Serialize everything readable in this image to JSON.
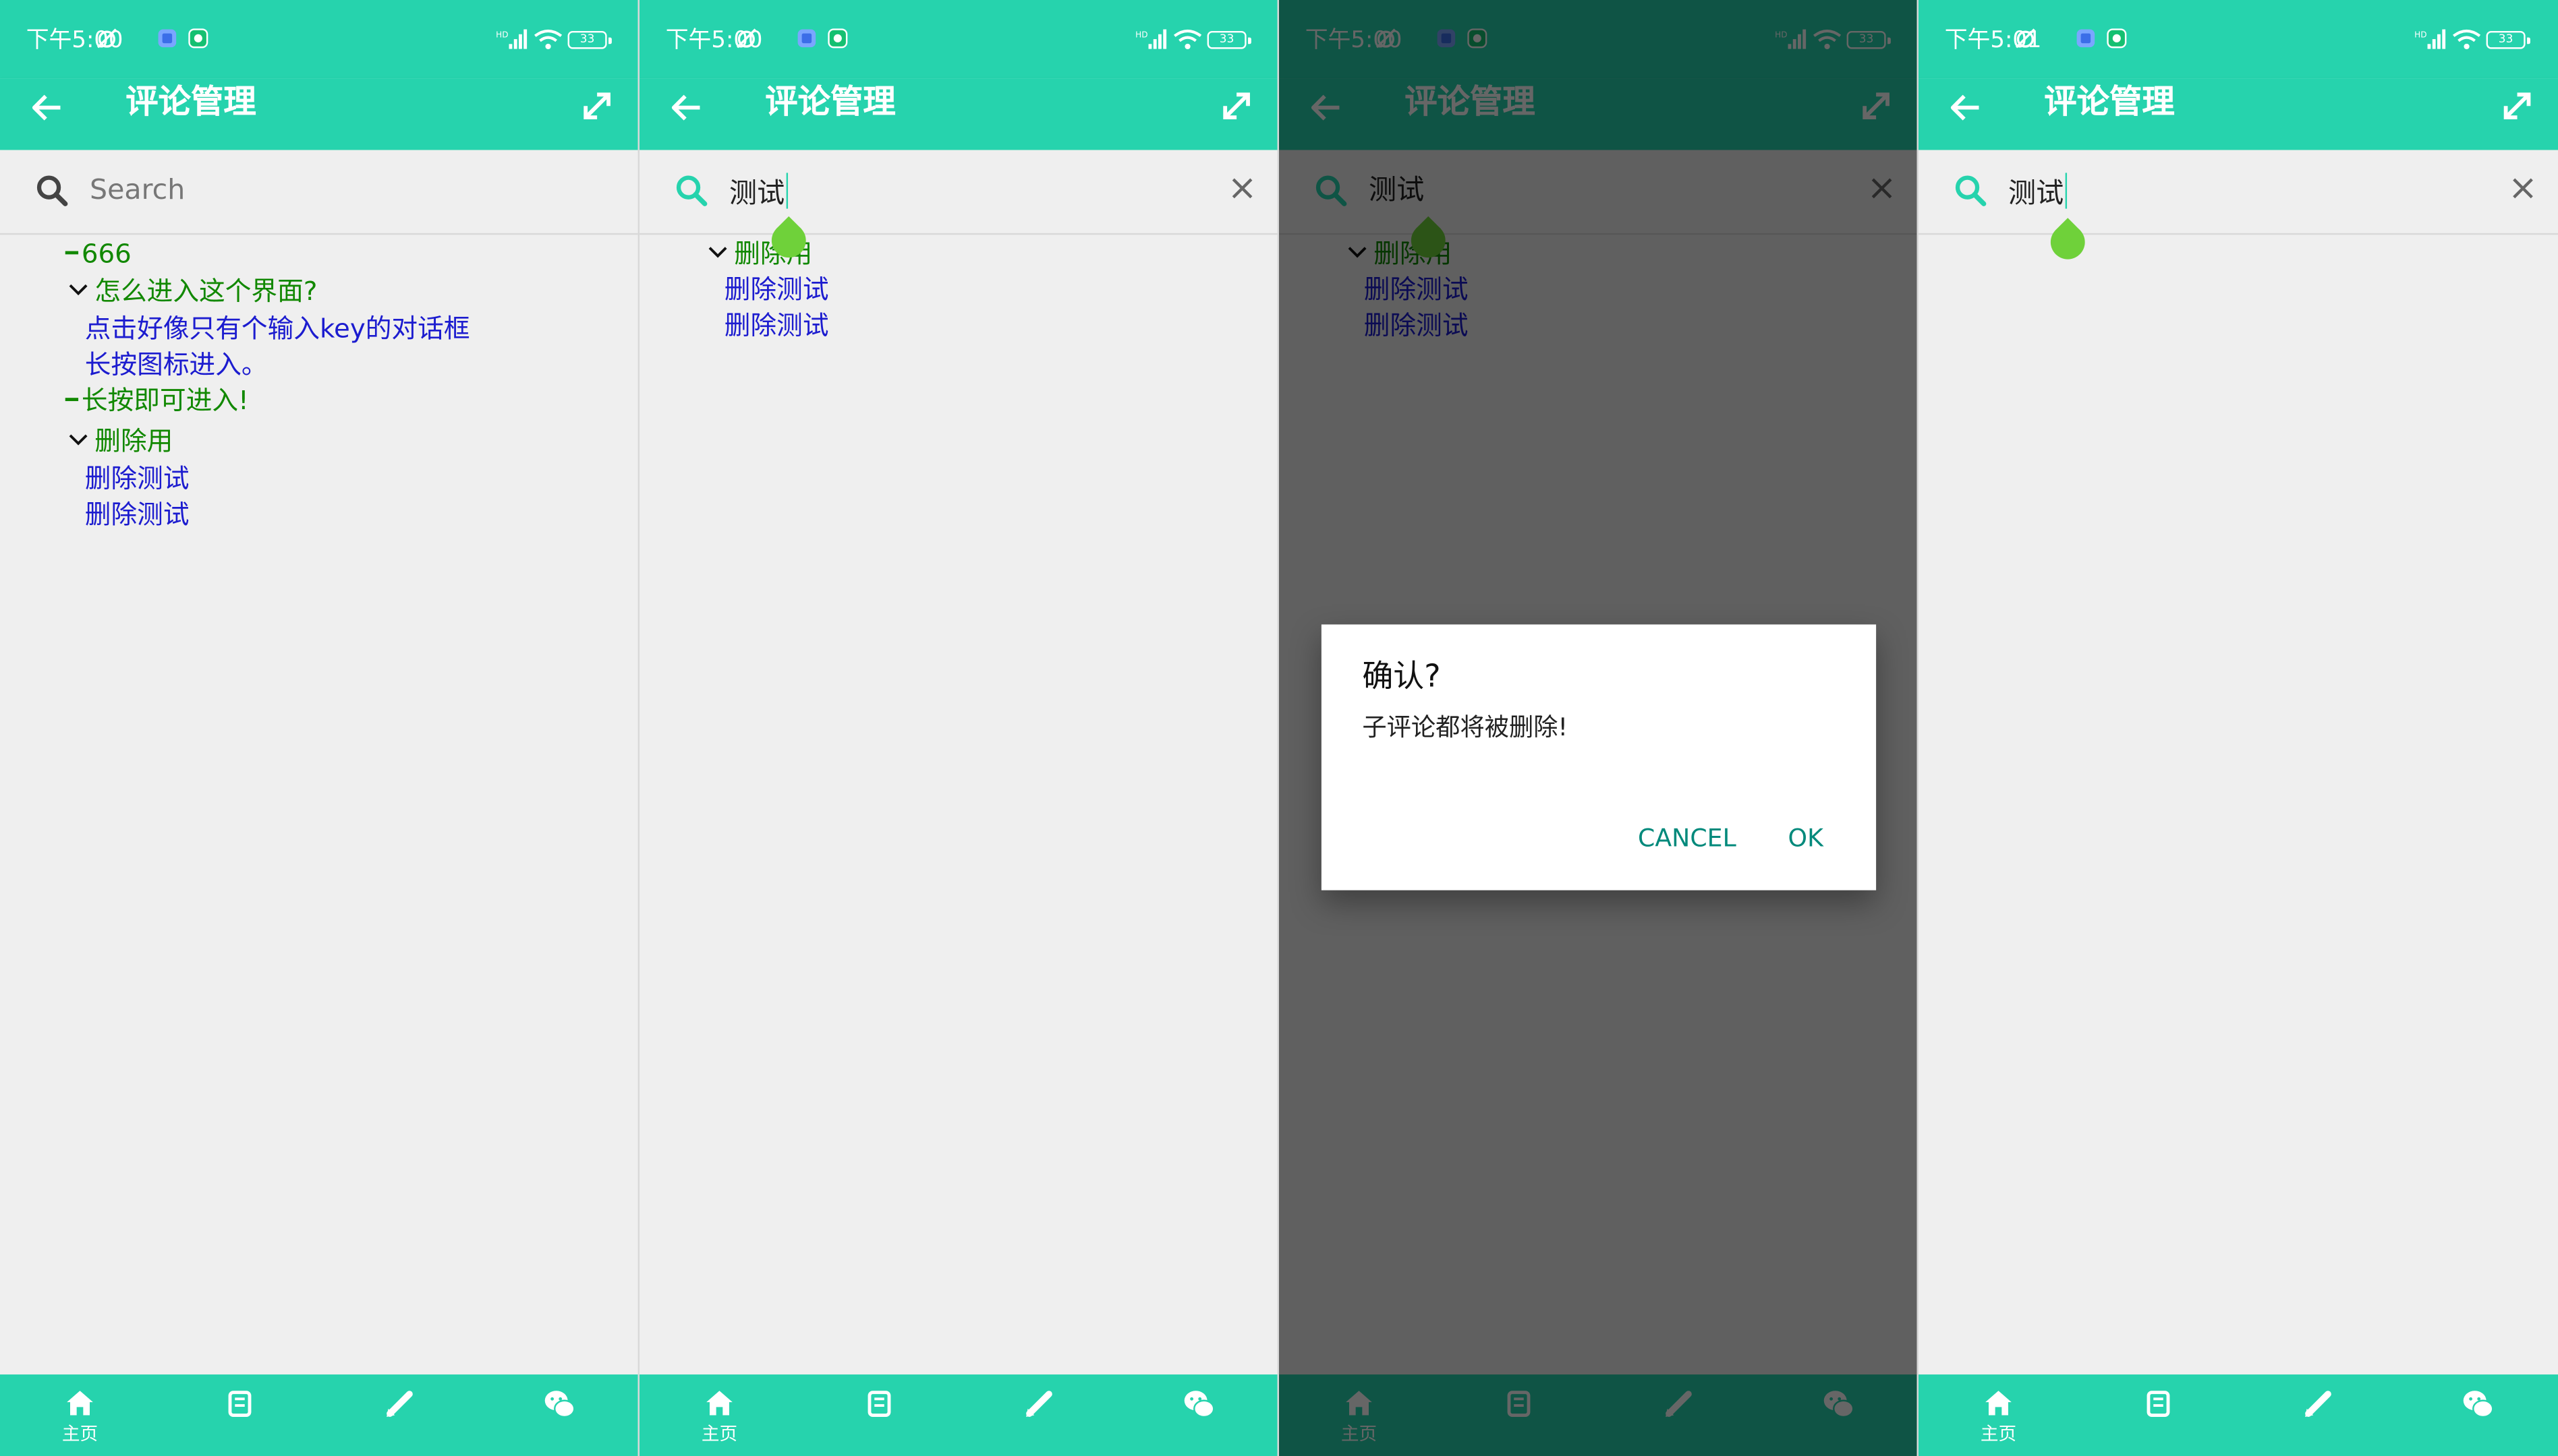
{
  "status_times": [
    "下午5:00",
    "下午5:00",
    "下午5:00",
    "下午5:01"
  ],
  "battery_labels": [
    "33",
    "33",
    "33",
    "33"
  ],
  "app": {
    "title": "评论管理"
  },
  "search": {
    "placeholder": "Search",
    "query": "测试"
  },
  "bottom_nav": {
    "home": "主页"
  },
  "panel1": {
    "tree": [
      {
        "kind": "dash",
        "text": "666",
        "color": "green"
      },
      {
        "kind": "chevron",
        "text": "怎么进入这个界面?",
        "color": "green"
      },
      {
        "kind": "leaf",
        "text": "点击好像只有个输入key的对话框",
        "color": "blue"
      },
      {
        "kind": "leaf",
        "text": "长按图标进入。",
        "color": "blue"
      },
      {
        "kind": "dash",
        "text": "长按即可进入!",
        "color": "green"
      },
      {
        "kind": "chevron",
        "text": "删除用",
        "color": "green"
      },
      {
        "kind": "leaf",
        "text": "删除测试",
        "color": "blue"
      },
      {
        "kind": "leaf",
        "text": "删除测试",
        "color": "blue"
      }
    ]
  },
  "panel2": {
    "tree": [
      {
        "kind": "chevron",
        "text": "删除用",
        "color": "green"
      },
      {
        "kind": "leaf",
        "text": "删除测试",
        "color": "blue"
      },
      {
        "kind": "leaf",
        "text": "删除测试",
        "color": "blue"
      }
    ]
  },
  "dialog": {
    "title": "确认?",
    "message": "子评论都将被删除!",
    "cancel": "CANCEL",
    "ok": "OK"
  },
  "colors": {
    "primary": "#26d3ad",
    "green_text": "#118800",
    "blue_text": "#1c1ccf",
    "dialog_button": "#00897b"
  },
  "icons": [
    "back-arrow-icon",
    "expand-icon",
    "search-icon",
    "clear-icon",
    "home-icon",
    "book-icon",
    "pencil-icon",
    "wechat-icon"
  ]
}
